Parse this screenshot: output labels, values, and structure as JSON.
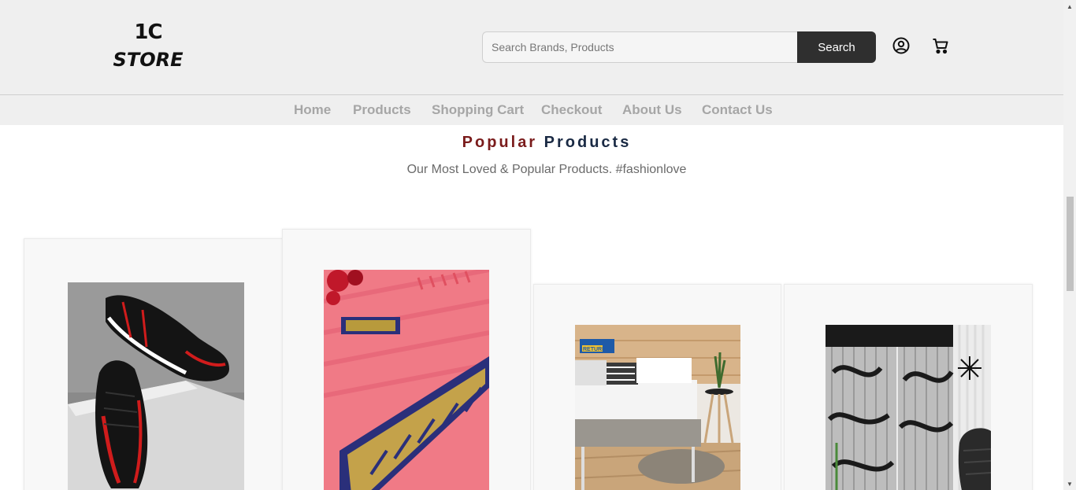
{
  "header": {
    "logo": {
      "top": "1C",
      "bottom": "STORE"
    },
    "search": {
      "placeholder": "Search Brands, Products",
      "button_label": "Search"
    },
    "icons": {
      "account": "account-circle-icon",
      "cart": "shopping-cart-icon"
    }
  },
  "nav": {
    "items": [
      {
        "label": "Home"
      },
      {
        "label": "Products"
      },
      {
        "label": "Shopping Cart"
      },
      {
        "label": "Checkout"
      },
      {
        "label": "About Us"
      },
      {
        "label": "Contact Us"
      }
    ]
  },
  "section": {
    "title_part1": "Popular",
    "title_part2": "Products",
    "subtitle": "Our Most Loved & Popular Products. #fashionlove"
  },
  "products": [
    {
      "image": "sports-shoes-image"
    },
    {
      "image": "pink-saree-image"
    },
    {
      "image": "mattress-bed-image",
      "badge": "RETURN"
    },
    {
      "image": "window-curtains-image"
    }
  ],
  "colors": {
    "header_bg": "#efefef",
    "search_button": "#2f2f2f",
    "title_red": "#7a1b1b",
    "title_blue": "#1a2a44",
    "nav_text": "#a6a6a6"
  }
}
